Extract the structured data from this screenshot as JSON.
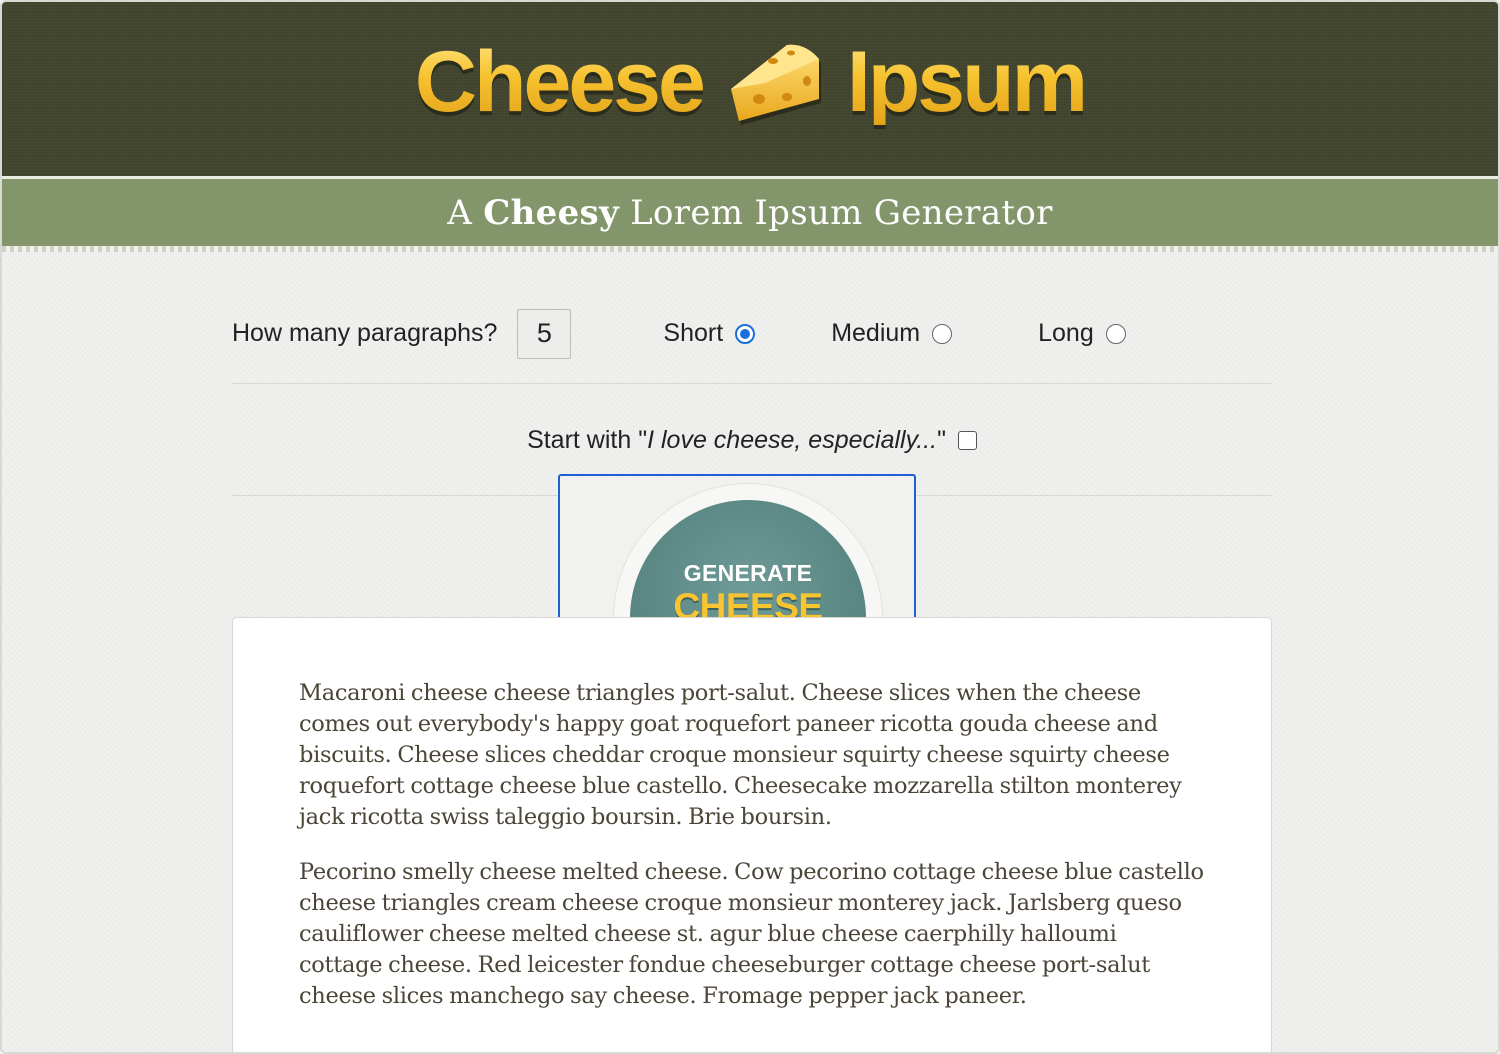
{
  "header": {
    "logo_left": "Cheese",
    "logo_right": "Ipsum",
    "logo_icon": "cheese-wedge-icon"
  },
  "tagline": {
    "prefix": "A ",
    "bold": "Cheesy",
    "suffix": " Lorem Ipsum Generator"
  },
  "controls": {
    "paragraphs_label": "How many paragraphs?",
    "paragraphs_value": "5",
    "options": [
      {
        "label": "Short",
        "checked": true
      },
      {
        "label": "Medium",
        "checked": false
      },
      {
        "label": "Long",
        "checked": false
      }
    ],
    "start_prefix": "Start with \"",
    "start_italic": "I love cheese, especially...",
    "start_suffix": "\"",
    "start_checked": false
  },
  "generate_button": {
    "top": "GENERATE",
    "main": "CHEESE"
  },
  "colors": {
    "header_bg": "#43462f",
    "band_bg": "#83956a",
    "logo_yellow": "#f6c12e",
    "button_teal": "#5a8683",
    "focus_blue": "#1f5fd0"
  },
  "output": {
    "paragraphs": [
      "Macaroni cheese cheese triangles port-salut. Cheese slices when the cheese comes out everybody's happy goat roquefort paneer ricotta gouda cheese and biscuits. Cheese slices cheddar croque monsieur squirty cheese squirty cheese roquefort cottage cheese blue castello. Cheesecake mozzarella stilton monterey jack ricotta swiss taleggio boursin. Brie boursin.",
      "Pecorino smelly cheese melted cheese. Cow pecorino cottage cheese blue castello cheese triangles cream cheese croque monsieur monterey jack. Jarlsberg queso cauliflower cheese melted cheese st. agur blue cheese caerphilly halloumi cottage cheese. Red leicester fondue cheeseburger cottage cheese port-salut cheese slices manchego say cheese. Fromage pepper jack paneer."
    ]
  }
}
